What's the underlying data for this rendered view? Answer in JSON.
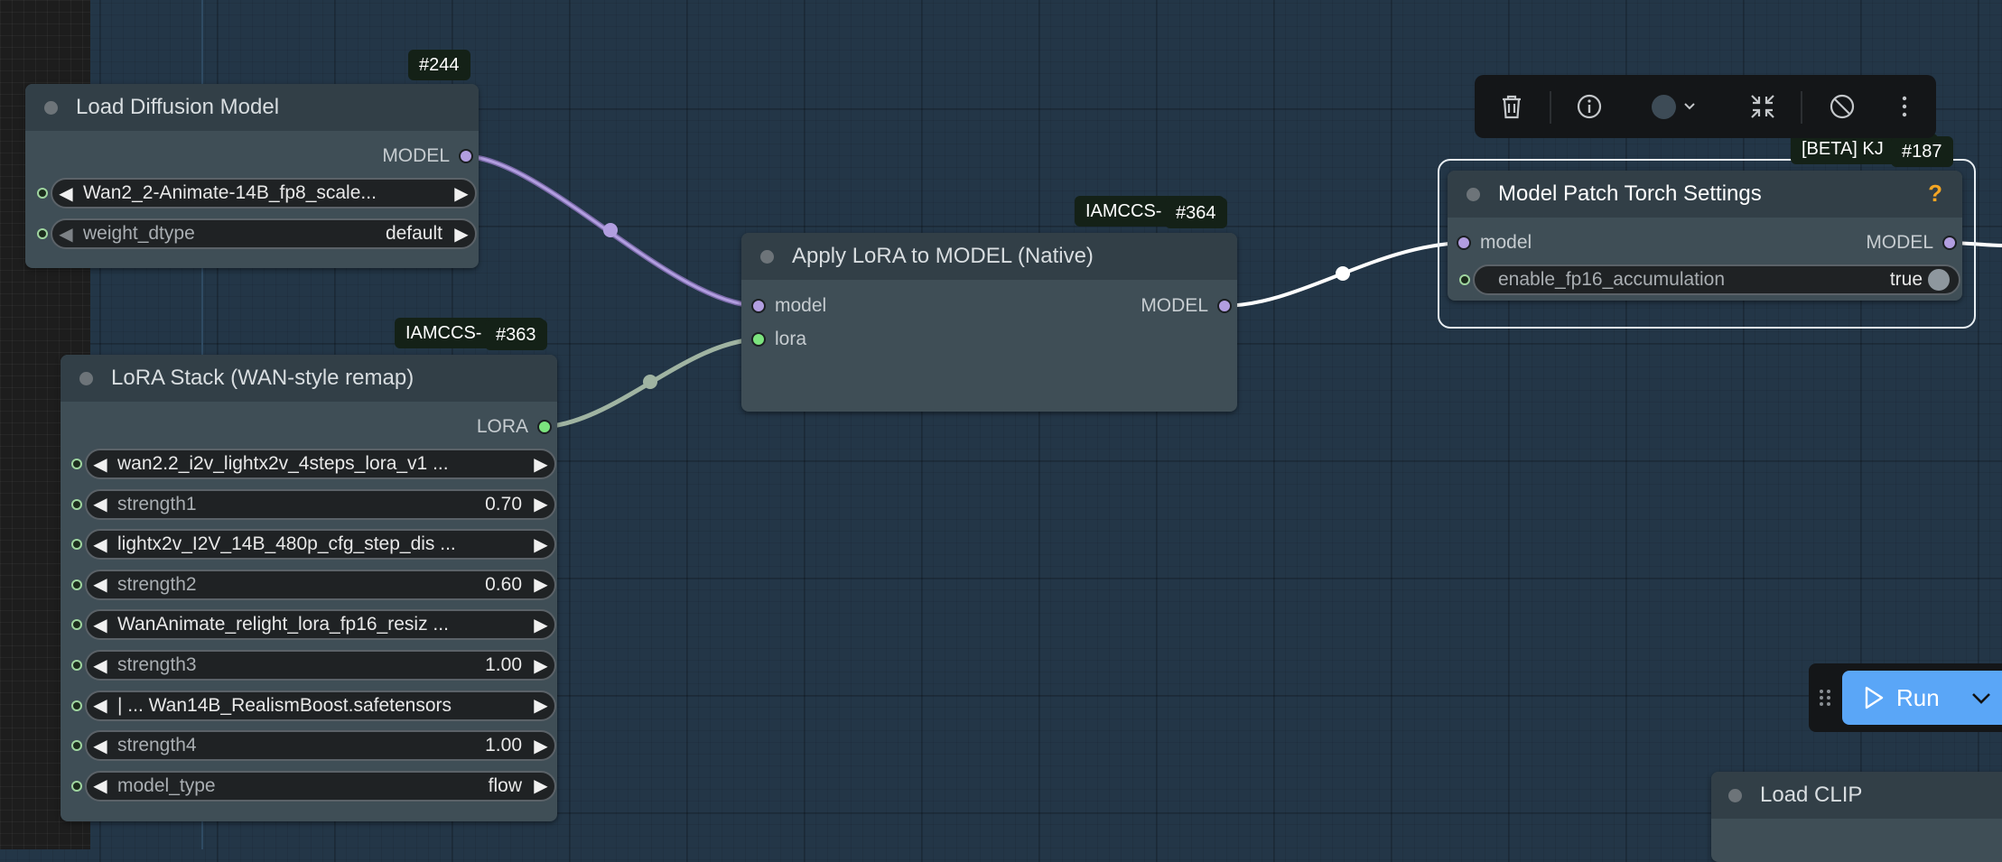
{
  "nodes": {
    "load_diffusion": {
      "badge_id": "#244",
      "title": "Load Diffusion Model",
      "output_label": "MODEL",
      "widgets": [
        {
          "label": "Wan2_2-Animate-14B_fp8_scale...",
          "value": ""
        },
        {
          "label": "weight_dtype",
          "value": "default"
        }
      ]
    },
    "lora_stack": {
      "badge_tag": "IAMCCS-",
      "badge_id": "#363",
      "title": "LoRA Stack (WAN-style remap)",
      "output_label": "LORA",
      "widgets": [
        {
          "label": "wan2.2_i2v_lightx2v_4steps_lora_v1  ...",
          "value": ""
        },
        {
          "label": "strength1",
          "value": "0.70"
        },
        {
          "label": "lightx2v_I2V_14B_480p_cfg_step_dis ...",
          "value": ""
        },
        {
          "label": "strength2",
          "value": "0.60"
        },
        {
          "label": "WanAnimate_relight_lora_fp16_resiz  ...",
          "value": ""
        },
        {
          "label": "strength3",
          "value": "1.00"
        },
        {
          "label": "| ...  Wan14B_RealismBoost.safetensors",
          "value": ""
        },
        {
          "label": "strength4",
          "value": "1.00"
        },
        {
          "label": "model_type",
          "value": "flow"
        }
      ]
    },
    "apply_lora": {
      "badge_tag": "IAMCCS-",
      "badge_id": "#364",
      "title": "Apply LoRA to MODEL (Native)",
      "inputs": [
        "model",
        "lora"
      ],
      "output_label": "MODEL"
    },
    "model_patch": {
      "badge_tag": "[BETA] KJ",
      "badge_id": "#187",
      "title": "Model Patch Torch Settings",
      "help_mark": "?",
      "input_label": "model",
      "output_label": "MODEL",
      "toggle": {
        "label": "enable_fp16_accumulation",
        "value": "true"
      }
    },
    "load_clip": {
      "title": "Load CLIP"
    }
  },
  "toolbar": {
    "items": [
      "trash-icon",
      "info-icon",
      "color-picker-icon",
      "collapse-icon",
      "bypass-icon",
      "more-icon"
    ]
  },
  "run": {
    "label": "Run"
  },
  "colors": {
    "canvas": "#233647",
    "node_body": "#3f4e56",
    "node_header": "#323f47",
    "model_link": "#b29ee0",
    "lora_link": "#a0b4a2",
    "run_button": "#5aa6f7"
  }
}
